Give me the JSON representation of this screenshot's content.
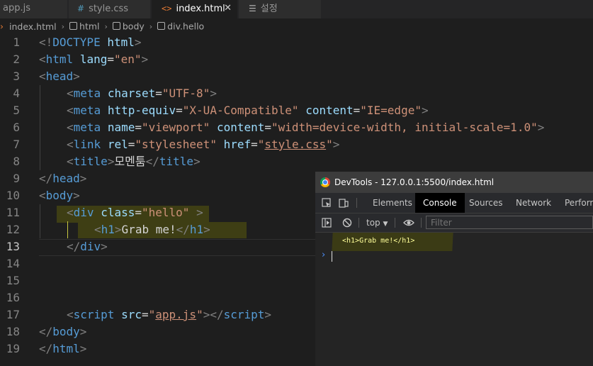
{
  "tabs": [
    {
      "label": "app.js",
      "icon": "js-file-icon"
    },
    {
      "label": "style.css",
      "icon": "hash-icon"
    },
    {
      "label": "index.html",
      "icon": "html-tag-icon",
      "active": true
    },
    {
      "label": "설정",
      "icon": "settings-list-icon"
    }
  ],
  "breadcrumb": {
    "file": "index.html",
    "items": [
      "html",
      "body",
      "div.hello"
    ]
  },
  "editor": {
    "line_numbers": [
      "1",
      "2",
      "3",
      "4",
      "5",
      "6",
      "7",
      "8",
      "9",
      "10",
      "11",
      "12",
      "13",
      "14",
      "15",
      "16",
      "17",
      "18",
      "19"
    ],
    "current_line": "13",
    "lines": {
      "l1": {
        "lt": "<!",
        "doctype": "DOCTYPE",
        "sp": " ",
        "html": "html",
        "gt": ">"
      },
      "l2": {
        "lt": "<",
        "tag": "html",
        "attr": "lang",
        "eq": "=",
        "val": "\"en\"",
        "gt": ">"
      },
      "l3": {
        "lt": "<",
        "tag": "head",
        "gt": ">"
      },
      "l4": {
        "lt": "<",
        "tag": "meta",
        "attr": "charset",
        "eq": "=",
        "val": "\"UTF-8\"",
        "gt": ">"
      },
      "l5": {
        "lt": "<",
        "tag": "meta",
        "attr1": "http-equiv",
        "eq1": "=",
        "val1": "\"X-UA-Compatible\"",
        "attr2": "content",
        "eq2": "=",
        "val2": "\"IE=edge\"",
        "gt": ">"
      },
      "l6": {
        "lt": "<",
        "tag": "meta",
        "attr1": "name",
        "eq1": "=",
        "val1": "\"viewport\"",
        "attr2": "content",
        "eq2": "=",
        "val2": "\"width=device-width, initial-scale=1.0\"",
        "gt": ">"
      },
      "l7": {
        "lt": "<",
        "tag": "link",
        "attr1": "rel",
        "eq1": "=",
        "val1": "\"stylesheet\"",
        "attr2": "href",
        "eq2": "=",
        "q1": "\"",
        "link": "style.css",
        "q2": "\"",
        "gt": ">"
      },
      "l8": {
        "lt": "<",
        "tag": "title",
        "gt": ">",
        "text": "모멘툼",
        "lt2": "</",
        "tag2": "title",
        "gt2": ">"
      },
      "l9": {
        "lt": "</",
        "tag": "head",
        "gt": ">"
      },
      "l10": {
        "lt": "<",
        "tag": "body",
        "gt": ">"
      },
      "l11": {
        "lt": "<",
        "tag": "div",
        "attr": "class",
        "eq": "=",
        "val": "\"hello\"",
        "gt": " >"
      },
      "l12": {
        "lt": "<",
        "tag": "h1",
        "gt": ">",
        "text": "Grab me!",
        "lt2": "</",
        "tag2": "h1",
        "gt2": ">"
      },
      "l13": {
        "lt": "</",
        "tag": "div",
        "gt": ">"
      },
      "l17": {
        "lt": "<",
        "tag": "script",
        "attr": "src",
        "eq": "=",
        "q1": "\"",
        "link": "app.js",
        "q2": "\"",
        "gt": ">",
        "lt2": "</",
        "tag2": "script",
        "gt2": ">"
      },
      "l18": {
        "lt": "</",
        "tag": "body",
        "gt": ">"
      },
      "l19": {
        "lt": "</",
        "tag": "html",
        "gt": ">"
      }
    }
  },
  "devtools": {
    "title": "DevTools - 127.0.0.1:5500/index.html",
    "tabs": [
      "Elements",
      "Console",
      "Sources",
      "Network",
      "Perform"
    ],
    "active_tab": "Console",
    "context": "top",
    "filter_placeholder": "Filter",
    "console_output": "<h1>Grab me!</h1>"
  },
  "colors": {
    "tag": "#569cd6",
    "attribute": "#9cdcfe",
    "string": "#ce9178",
    "punctuation": "#808080",
    "console_text": "#ffff99",
    "prompt": "#4d90fe"
  }
}
